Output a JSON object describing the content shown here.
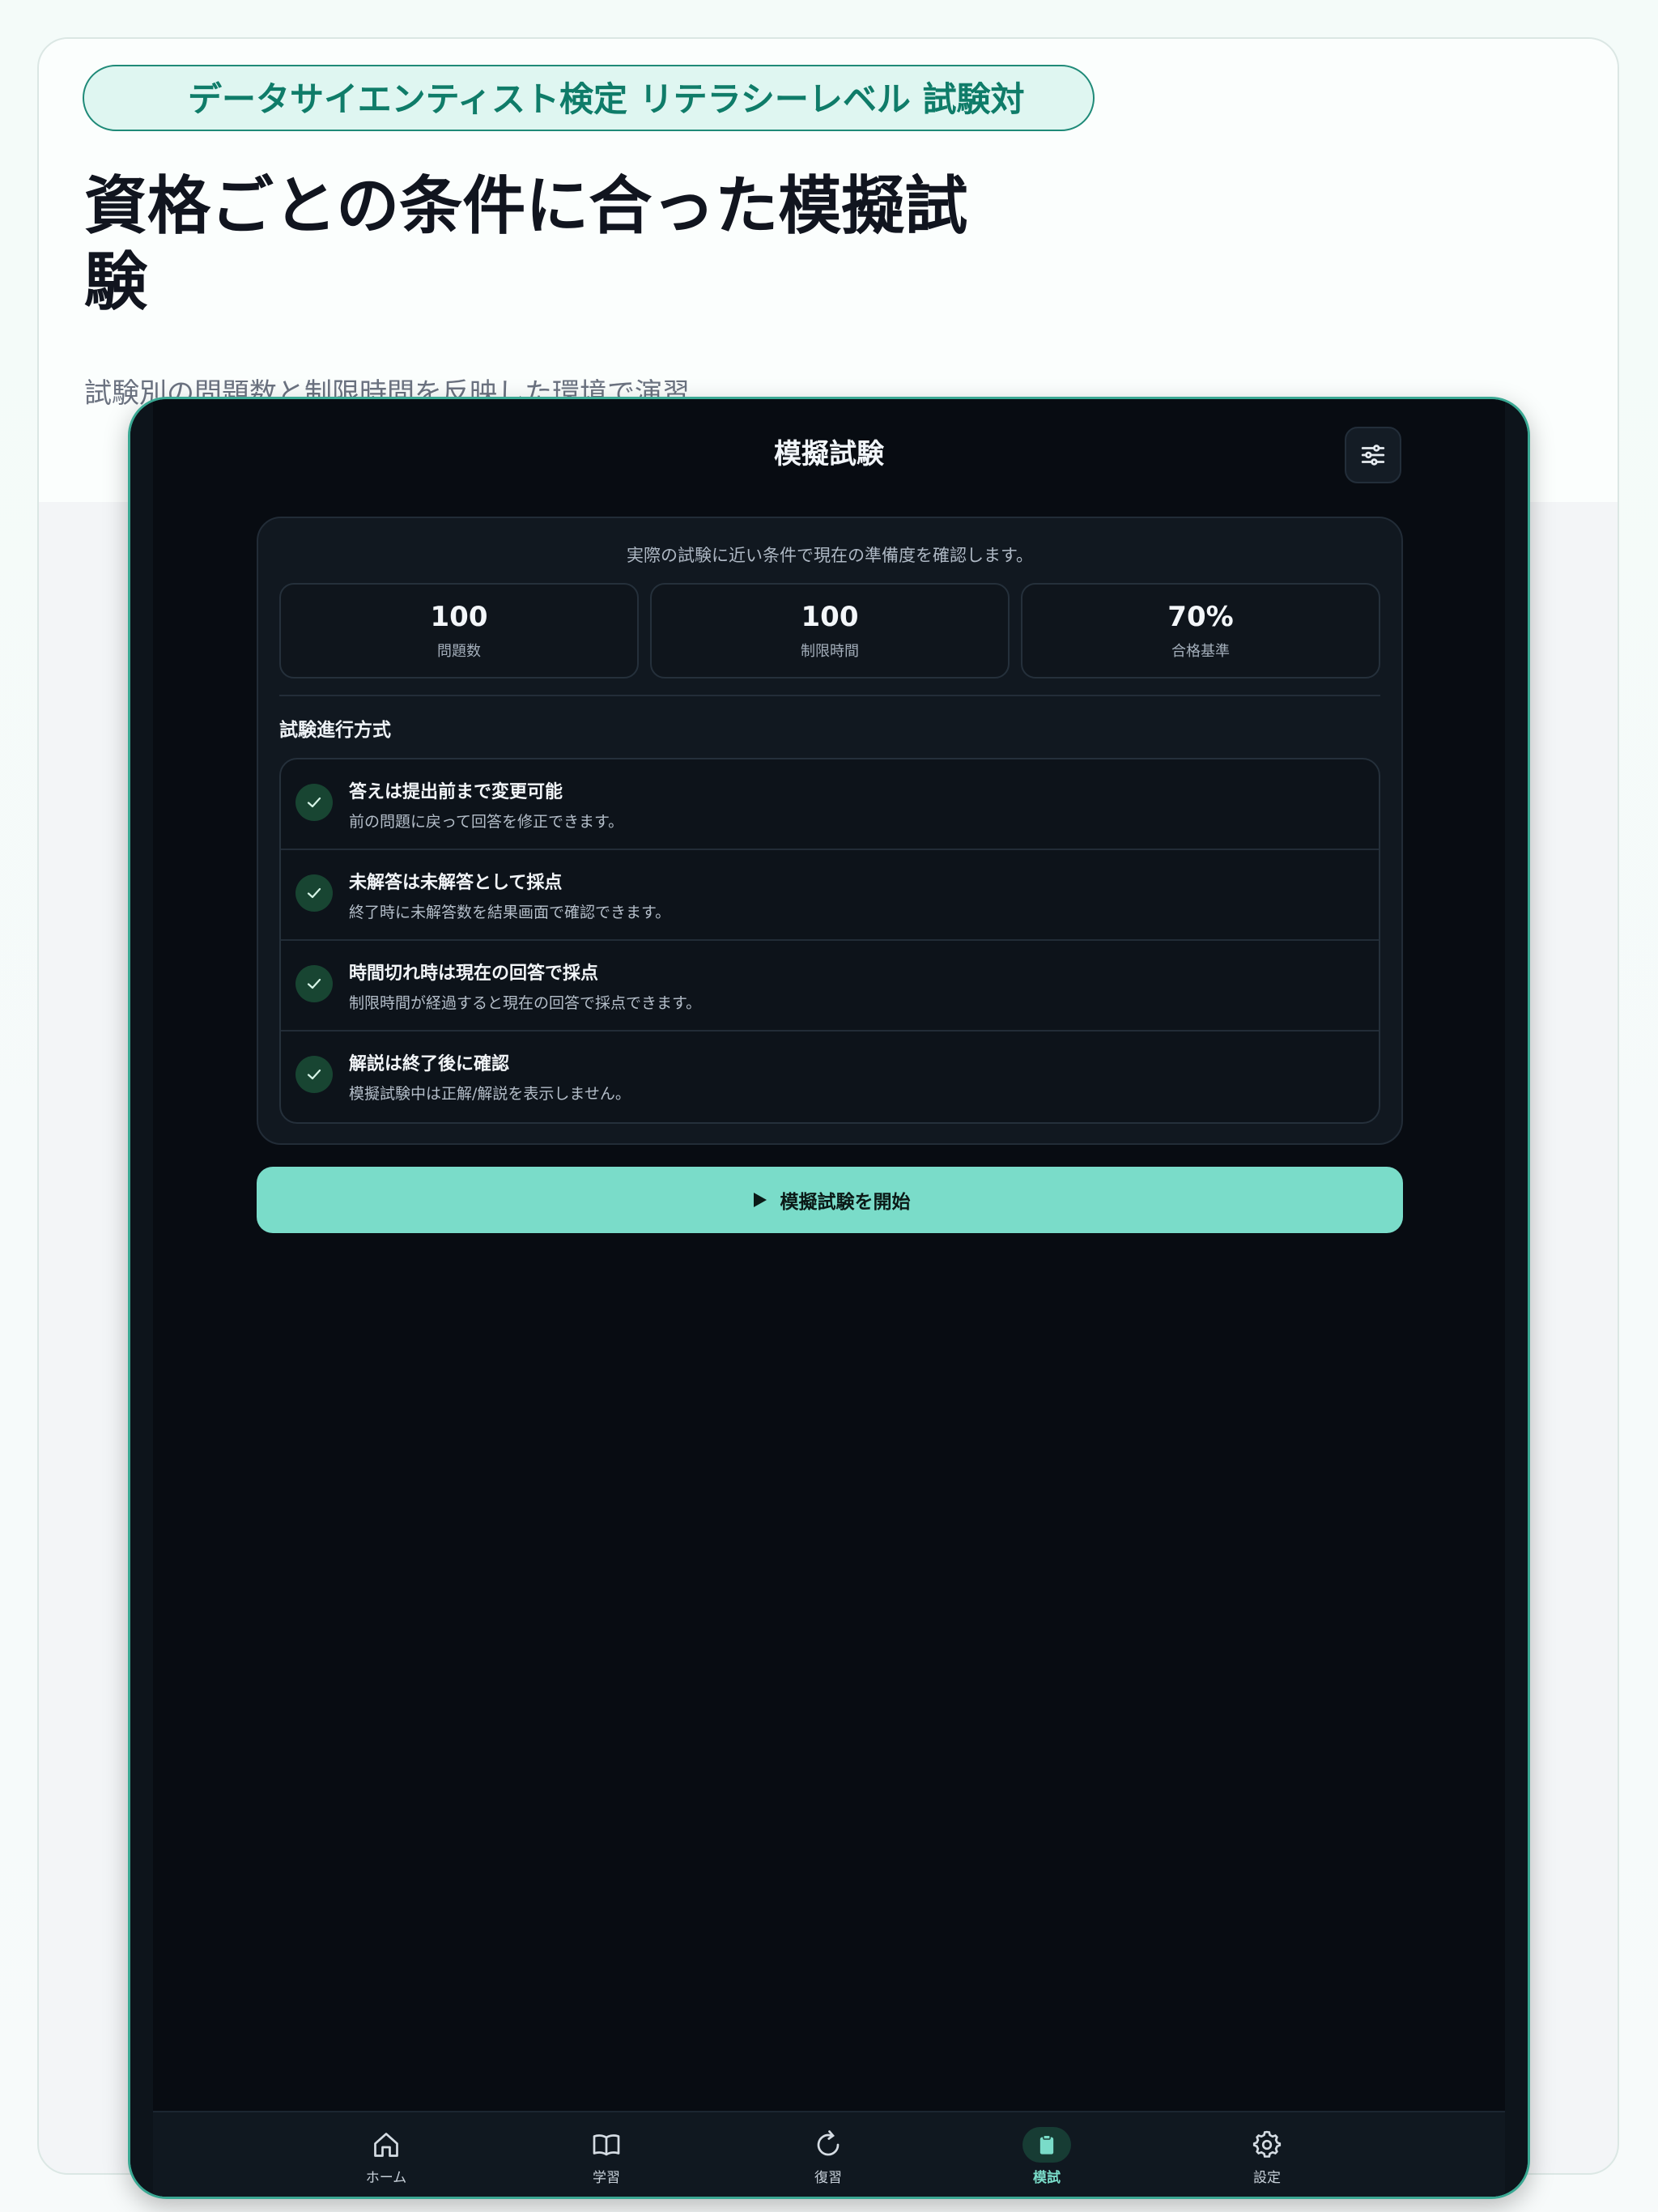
{
  "hero": {
    "badge": "データサイエンティスト検定 リテラシーレベル 試験対",
    "headline": "資格ごとの条件に合った模擬試験",
    "subline": "試験別の問題数と制限時間を反映した環境で演習"
  },
  "app": {
    "title": "模擬試験",
    "intro": "実際の試験に近い条件で現在の準備度を確認します。",
    "stats": [
      {
        "value": "100",
        "label": "問題数"
      },
      {
        "value": "100",
        "label": "制限時間"
      },
      {
        "value": "70%",
        "label": "合格基準"
      }
    ],
    "section_title": "試験進行方式",
    "rules": [
      {
        "title": "答えは提出前まで変更可能",
        "desc": "前の問題に戻って回答を修正できます。"
      },
      {
        "title": "未解答は未解答として採点",
        "desc": "終了時に未解答数を結果画面で確認できます。"
      },
      {
        "title": "時間切れ時は現在の回答で採点",
        "desc": "制限時間が経過すると現在の回答で採点できます。"
      },
      {
        "title": "解説は終了後に確認",
        "desc": "模擬試験中は正解/解説を表示しません。"
      }
    ],
    "start_label": "模擬試験を開始",
    "tabs": [
      {
        "label": "ホーム",
        "icon": "home-icon"
      },
      {
        "label": "学習",
        "icon": "book-icon"
      },
      {
        "label": "復習",
        "icon": "refresh-icon"
      },
      {
        "label": "模試",
        "icon": "clipboard-icon",
        "active": true
      },
      {
        "label": "設定",
        "icon": "gear-icon"
      }
    ]
  },
  "colors": {
    "accent": "#7adcc9",
    "badge_text": "#0f7c69",
    "screen_bg": "#080c12"
  }
}
